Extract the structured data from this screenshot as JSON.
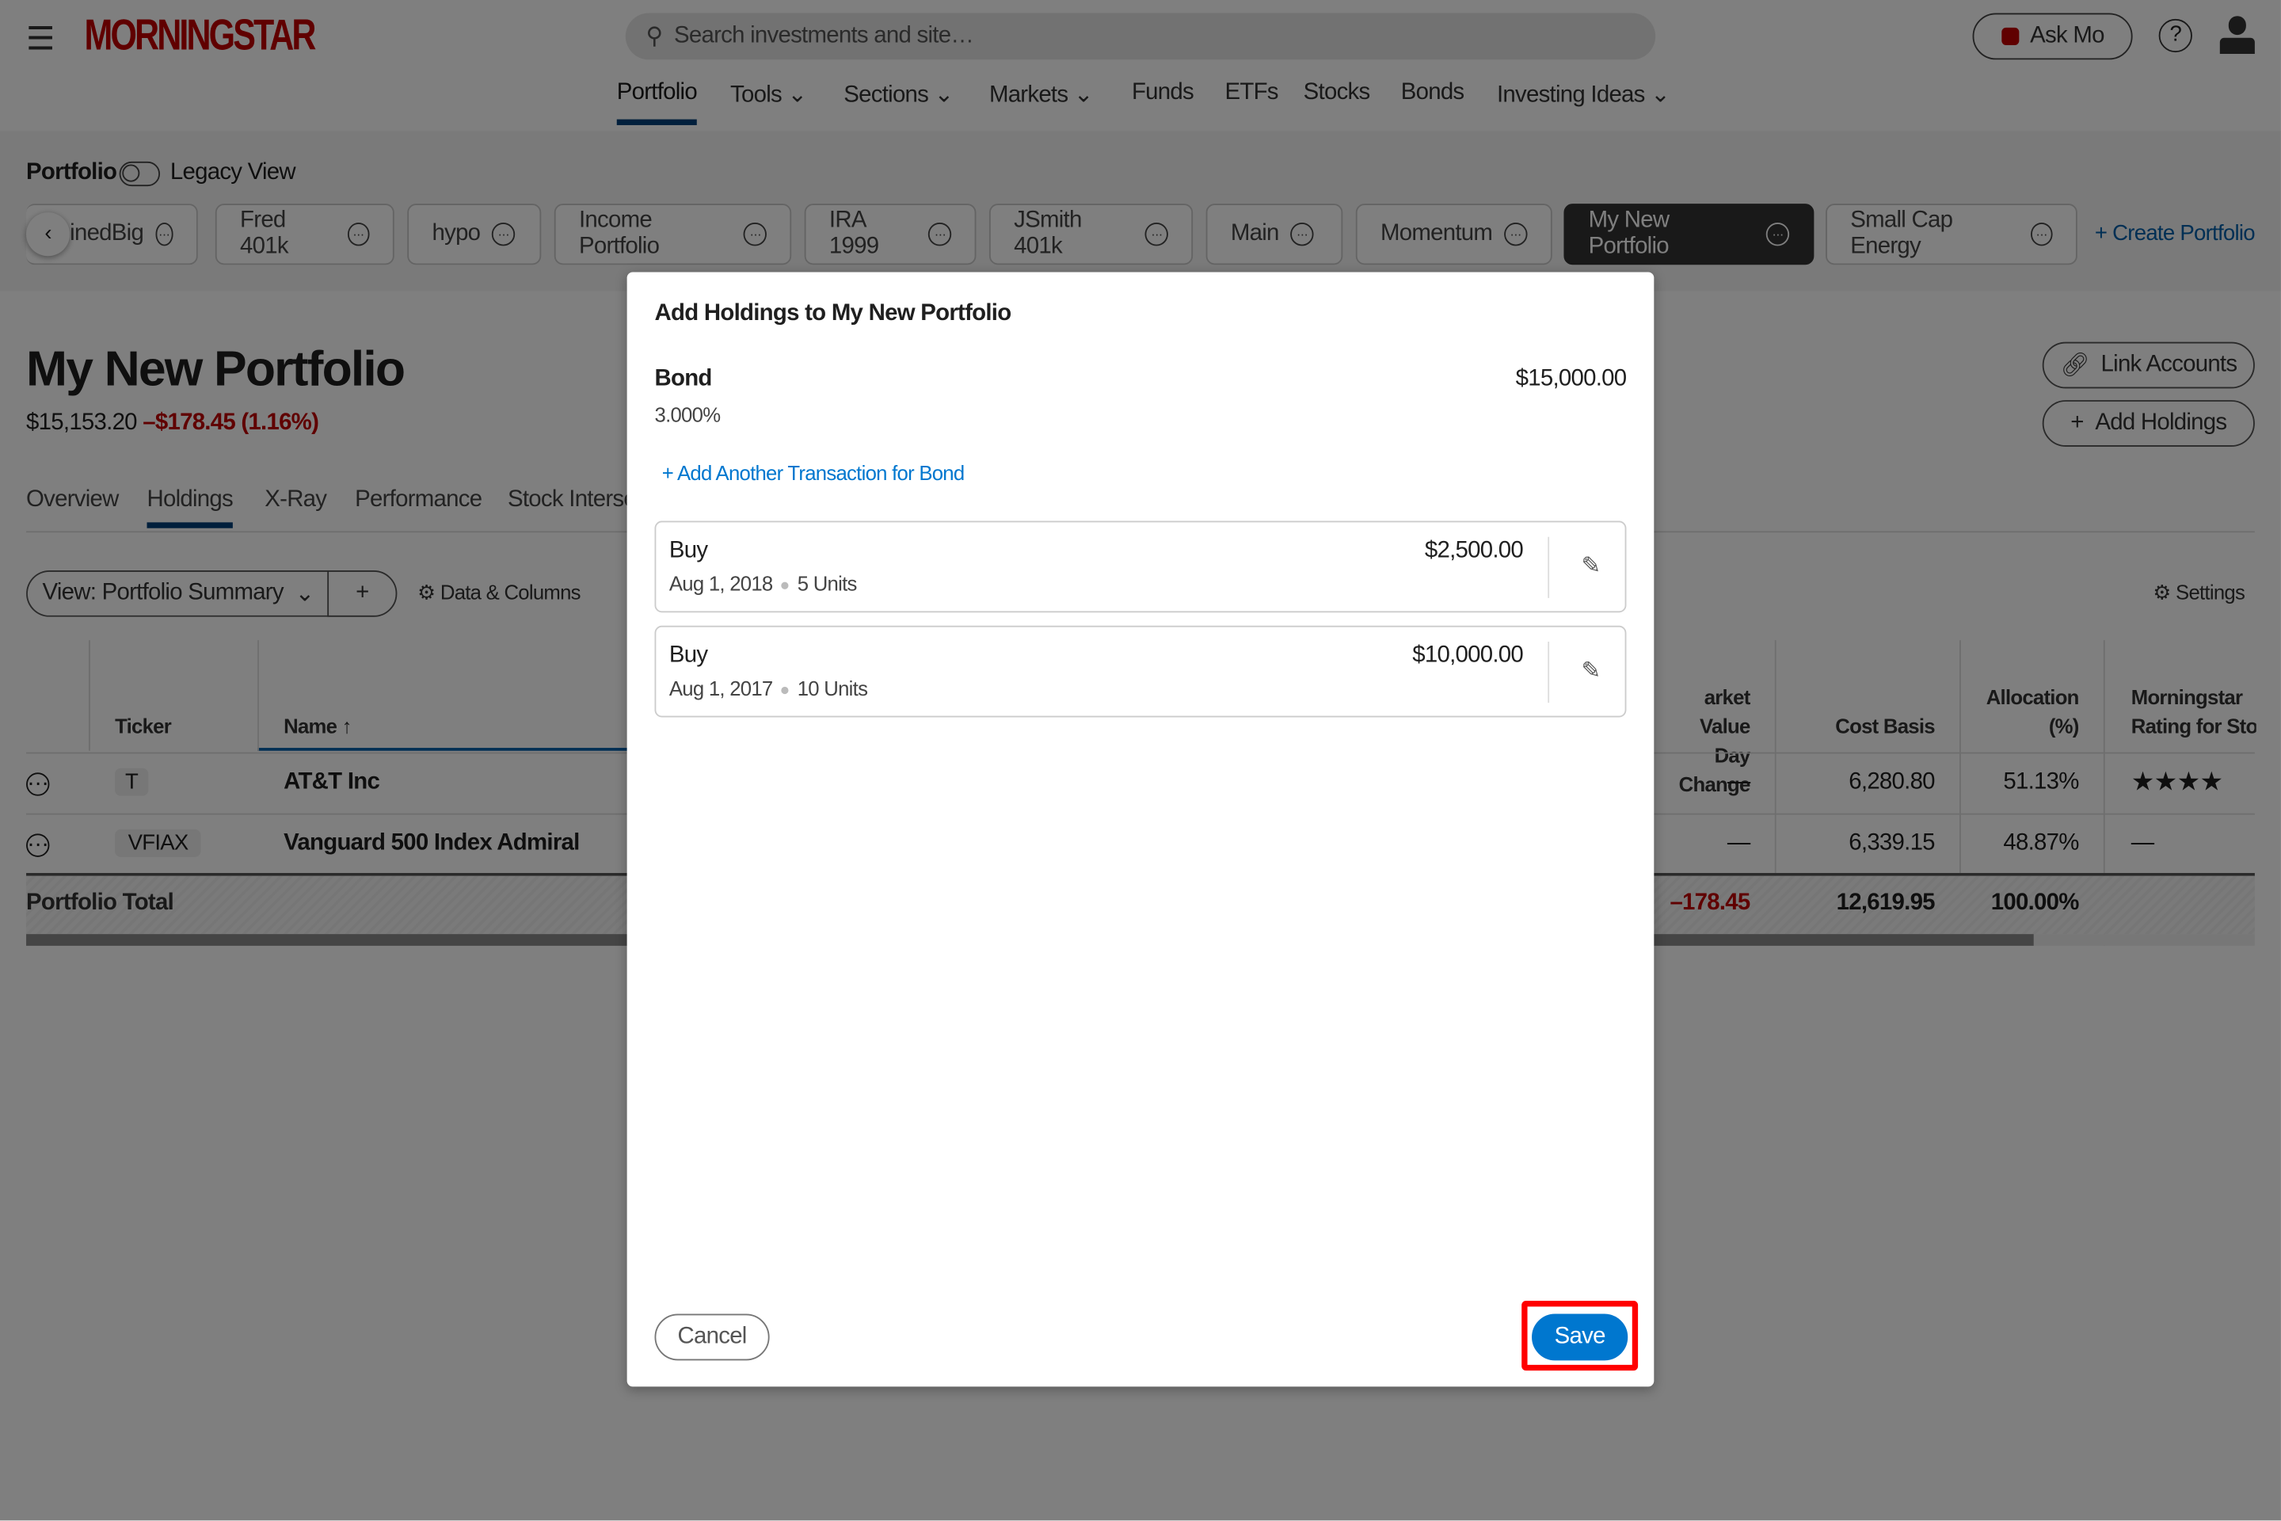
{
  "header": {
    "logo": "MORNINGSTAR",
    "search_placeholder": "Search investments and site…",
    "ask_mo": "Ask Mo",
    "brand_color": "#c00000",
    "nav": [
      {
        "label": "Portfolio",
        "active": true
      },
      {
        "label": "Tools",
        "dropdown": true
      },
      {
        "label": "Sections",
        "dropdown": true
      },
      {
        "label": "Markets",
        "dropdown": true
      },
      {
        "label": "Funds"
      },
      {
        "label": "ETFs"
      },
      {
        "label": "Stocks"
      },
      {
        "label": "Bonds"
      },
      {
        "label": "Investing Ideas",
        "dropdown": true
      }
    ]
  },
  "portfolio_bar": {
    "label": "Portfolio",
    "legacy_toggle": "Legacy View",
    "legacy_on": false,
    "portfolios": [
      "inedBig",
      "Fred 401k",
      "hypo",
      "Income Portfolio",
      "IRA 1999",
      "JSmith 401k",
      "Main",
      "Momentum",
      "My New Portfolio",
      "Small Cap Energy"
    ],
    "selected": "My New Portfolio",
    "create": "Create Portfolio"
  },
  "page": {
    "title": "My New Portfolio",
    "value": "$15,153.20",
    "change": "–$178.45 (1.16%)",
    "link_accounts": "Link Accounts",
    "add_holdings": "Add Holdings",
    "tabs": [
      "Overview",
      "Holdings",
      "X-Ray",
      "Performance",
      "Stock Interse"
    ],
    "active_tab": "Holdings",
    "view_select": "View: Portfolio Summary",
    "data_columns": "Data & Columns",
    "settings": "Settings"
  },
  "table": {
    "headers": {
      "ticker": "Ticker",
      "name": "Name",
      "market_value_1": "arket Value",
      "market_value_2": "Day Change",
      "cost_basis": "Cost Basis",
      "allocation_1": "Allocation",
      "allocation_2": "(%)",
      "rating_1": "Morningstar",
      "rating_2": "Rating for Stoc"
    },
    "rows": [
      {
        "ticker": "T",
        "name": "AT&T Inc",
        "day_change": "—",
        "cost_basis": "6,280.80",
        "allocation": "51.13%",
        "rating": "★★★★"
      },
      {
        "ticker": "VFIAX",
        "name": "Vanguard 500 Index Admiral",
        "day_change": "—",
        "cost_basis": "6,339.15",
        "allocation": "48.87%",
        "rating": "—"
      }
    ],
    "total": {
      "label": "Portfolio Total",
      "day_change": "–178.45",
      "cost_basis": "12,619.95",
      "allocation": "100.00%"
    }
  },
  "modal": {
    "title": "Add Holdings to My New Portfolio",
    "holding": "Bond",
    "rate": "3.000%",
    "total": "$15,000.00",
    "add_txn": "Add Another Transaction for Bond",
    "transactions": [
      {
        "type": "Buy",
        "date": "Aug 1, 2018",
        "units": "5 Units",
        "amount": "$2,500.00"
      },
      {
        "type": "Buy",
        "date": "Aug 1, 2017",
        "units": "10 Units",
        "amount": "$10,000.00"
      }
    ],
    "cancel": "Cancel",
    "save": "Save",
    "accent": "#0077cf",
    "highlight": "#ff0000"
  }
}
